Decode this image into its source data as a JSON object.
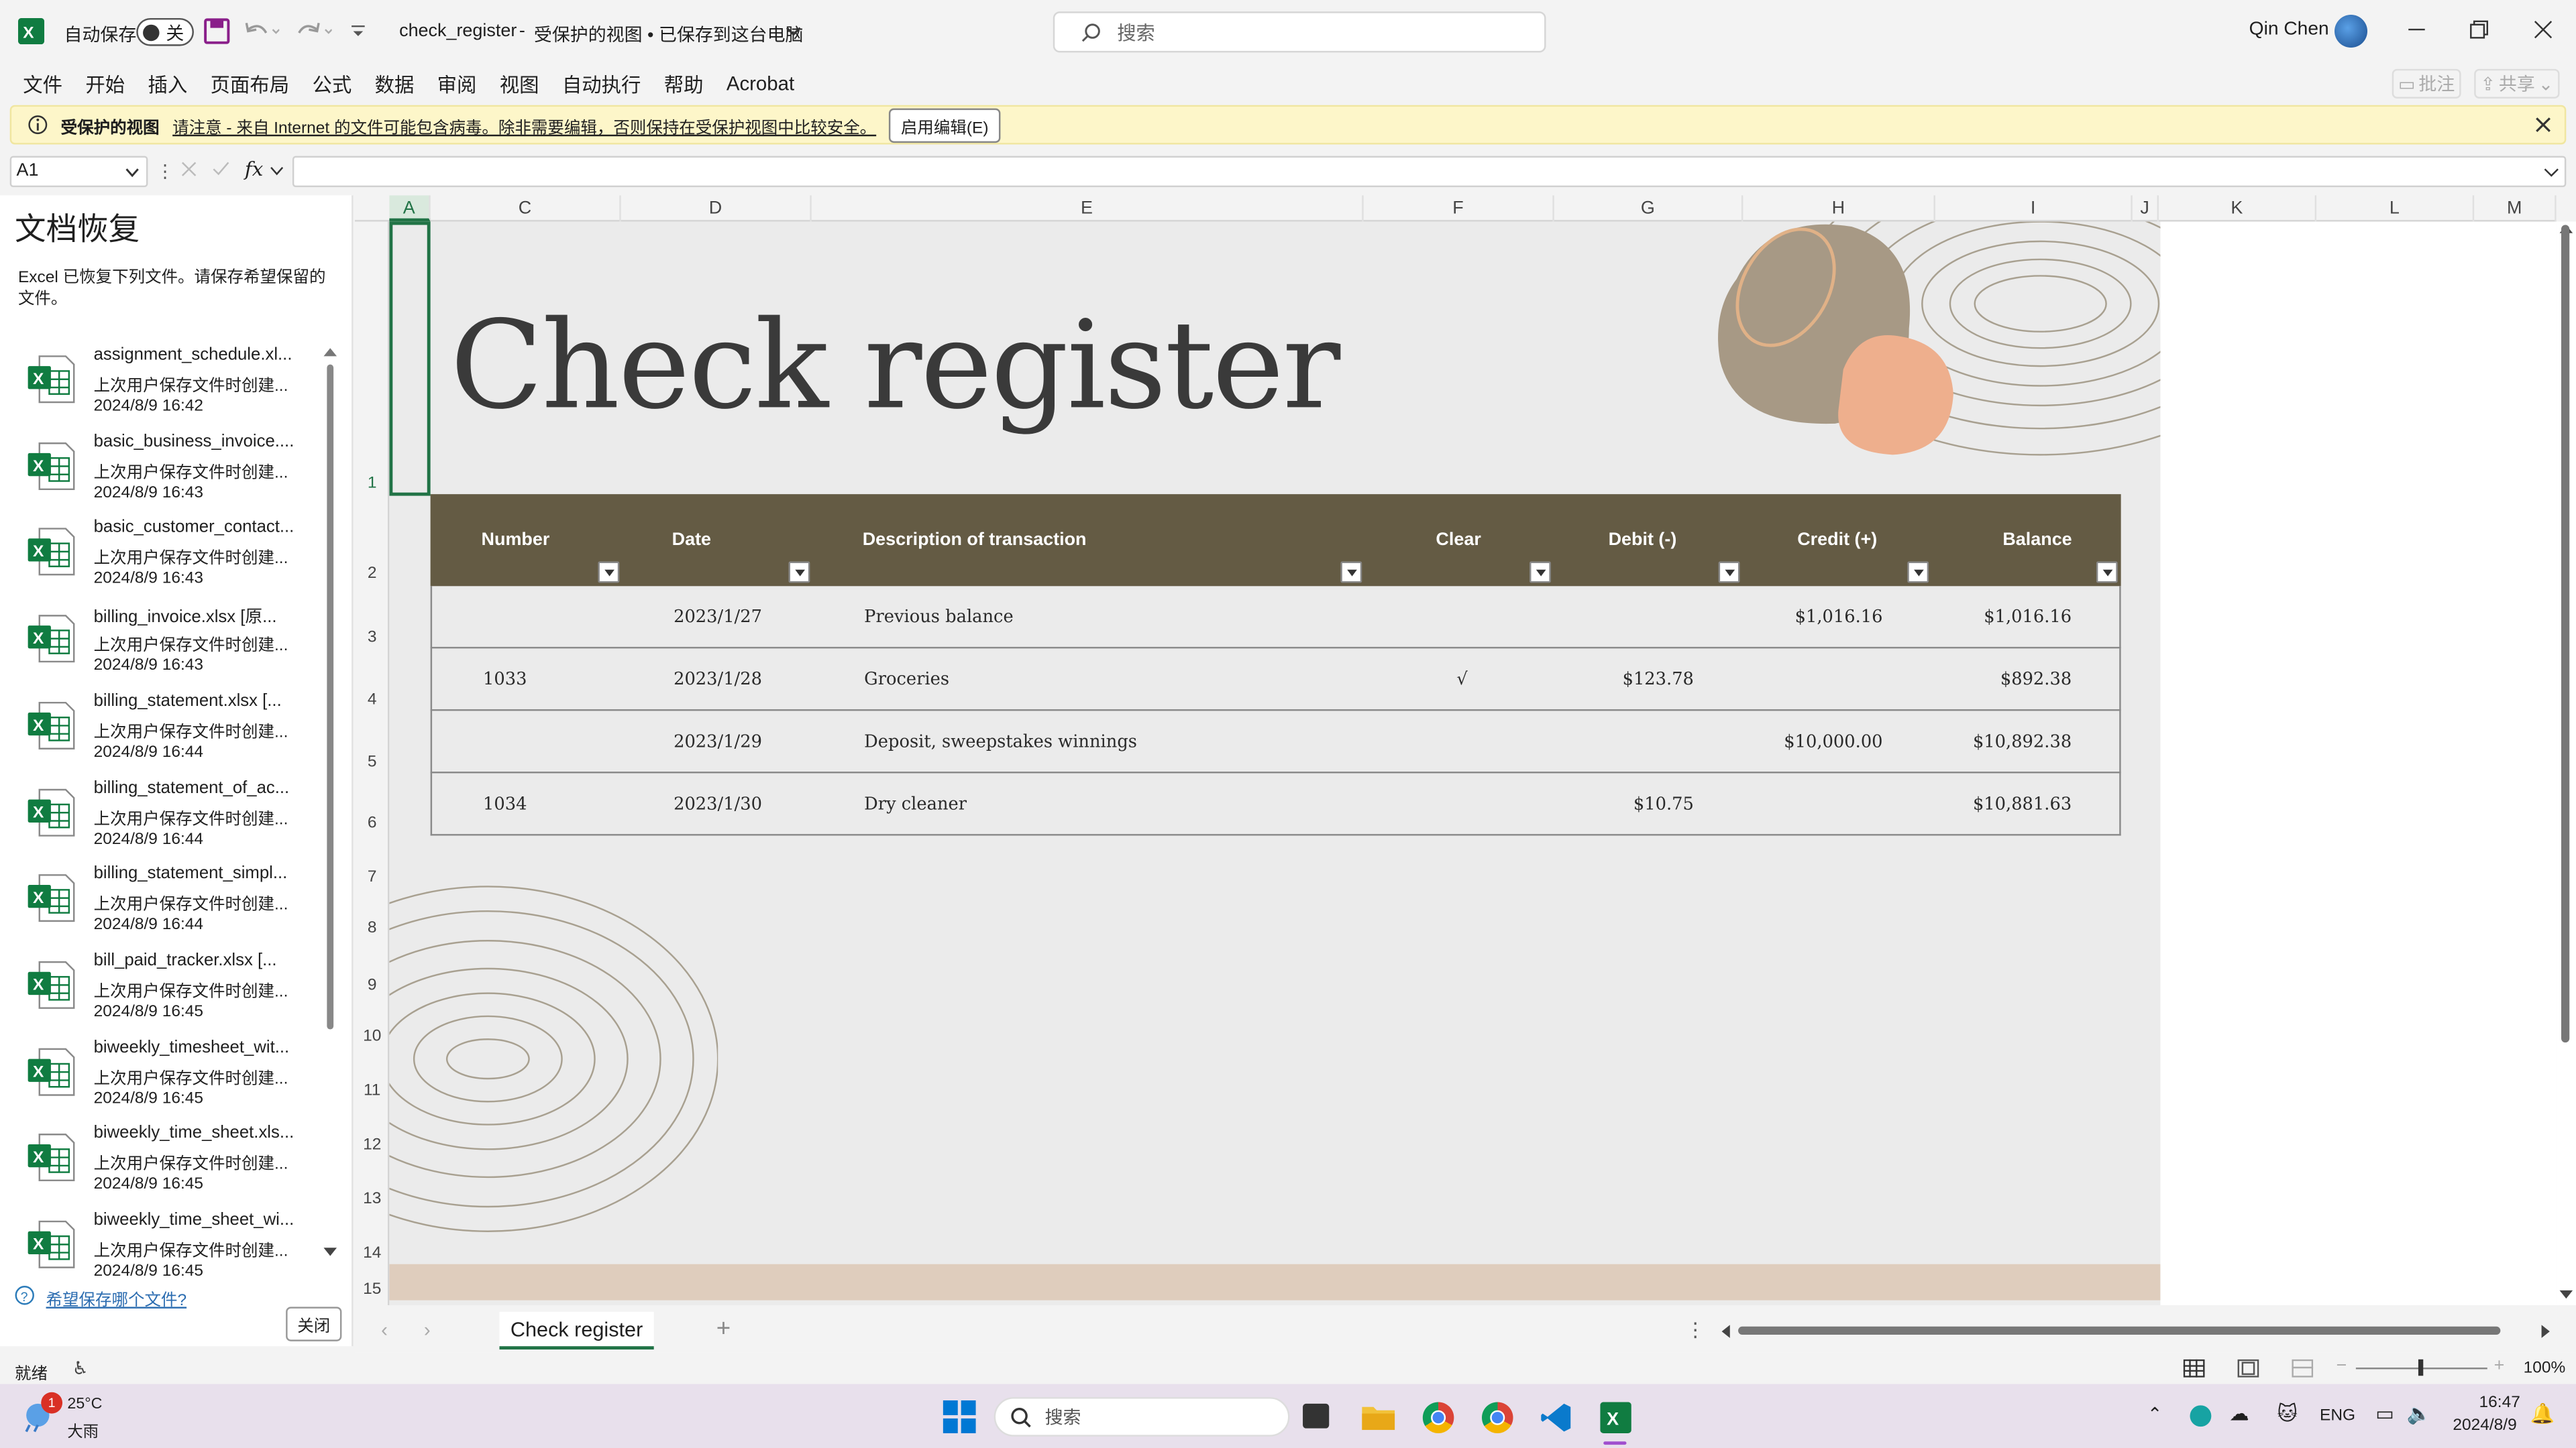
{
  "titlebar": {
    "autosave_label": "自动保存",
    "autosave_state": "关",
    "doc_title": "check_register",
    "doc_status": "受保护的视图 • 已保存到这台电脑",
    "search_placeholder": "搜索",
    "user": "Qin Chen"
  },
  "menu": [
    "文件",
    "开始",
    "插入",
    "页面布局",
    "公式",
    "数据",
    "审阅",
    "视图",
    "自动执行",
    "帮助",
    "Acrobat"
  ],
  "ribbon_right": {
    "comments": "批注",
    "share": "共享"
  },
  "protected": {
    "label": "受保护的视图",
    "message": "请注意 - 来自 Internet 的文件可能包含病毒。除非需要编辑，否则保持在受保护视图中比较安全。",
    "button": "启用编辑(E)"
  },
  "namebox": "A1",
  "pane": {
    "title": "文档恢复",
    "desc": "Excel 已恢复下列文件。请保存希望保留的文件。",
    "link": "希望保存哪个文件?",
    "close": "关闭",
    "items": [
      {
        "name": "assignment_schedule.xl...",
        "status": "上次用户保存文件时创建...",
        "time": "2024/8/9 16:42"
      },
      {
        "name": "basic_business_invoice....",
        "status": "上次用户保存文件时创建...",
        "time": "2024/8/9 16:43"
      },
      {
        "name": "basic_customer_contact...",
        "status": "上次用户保存文件时创建...",
        "time": "2024/8/9 16:43"
      },
      {
        "name": "billing_invoice.xlsx  [原...",
        "status": "上次用户保存文件时创建...",
        "time": "2024/8/9 16:43"
      },
      {
        "name": "billing_statement.xlsx  [...",
        "status": "上次用户保存文件时创建...",
        "time": "2024/8/9 16:44"
      },
      {
        "name": "billing_statement_of_ac...",
        "status": "上次用户保存文件时创建...",
        "time": "2024/8/9 16:44"
      },
      {
        "name": "billing_statement_simpl...",
        "status": "上次用户保存文件时创建...",
        "time": "2024/8/9 16:44"
      },
      {
        "name": "bill_paid_tracker.xlsx  [...",
        "status": "上次用户保存文件时创建...",
        "time": "2024/8/9 16:45"
      },
      {
        "name": "biweekly_timesheet_wit...",
        "status": "上次用户保存文件时创建...",
        "time": "2024/8/9 16:45"
      },
      {
        "name": "biweekly_time_sheet.xls...",
        "status": "上次用户保存文件时创建...",
        "time": "2024/8/9 16:45"
      },
      {
        "name": "biweekly_time_sheet_wi...",
        "status": "上次用户保存文件时创建...",
        "time": "2024/8/9 16:45"
      }
    ]
  },
  "columns": [
    "A",
    "C",
    "D",
    "E",
    "F",
    "G",
    "H",
    "I",
    "J",
    "K",
    "L",
    "M"
  ],
  "rows": [
    "1",
    "2",
    "3",
    "4",
    "5",
    "6",
    "7",
    "8",
    "9",
    "10",
    "11",
    "12",
    "13",
    "14",
    "15"
  ],
  "sheet": {
    "title": "Check register",
    "headers": {
      "number": "Number",
      "date": "Date",
      "desc": "Description of transaction",
      "clear": "Clear",
      "debit": "Debit  (-)",
      "credit": "Credit (+)",
      "balance": "Balance"
    },
    "rows": [
      {
        "number": "",
        "date": "2023/1/27",
        "desc": "Previous balance",
        "clear": "",
        "debit": "",
        "credit": "$1,016.16",
        "balance": "$1,016.16"
      },
      {
        "number": "1033",
        "date": "2023/1/28",
        "desc": "Groceries",
        "clear": "√",
        "debit": "$123.78",
        "credit": "",
        "balance": "$892.38"
      },
      {
        "number": "",
        "date": "2023/1/29",
        "desc": "Deposit, sweepstakes winnings",
        "clear": "",
        "debit": "",
        "credit": "$10,000.00",
        "balance": "$10,892.38"
      },
      {
        "number": "1034",
        "date": "2023/1/30",
        "desc": "Dry cleaner",
        "clear": "",
        "debit": "$10.75",
        "credit": "",
        "balance": "$10,881.63"
      }
    ]
  },
  "tab": "Check register",
  "status": {
    "ready": "就绪",
    "zoom": "100%"
  },
  "taskbar": {
    "temp": "25°C",
    "weather": "大雨",
    "search": "搜索",
    "lang": "ENG",
    "time": "16:47",
    "date": "2024/8/9",
    "badge": "1"
  }
}
